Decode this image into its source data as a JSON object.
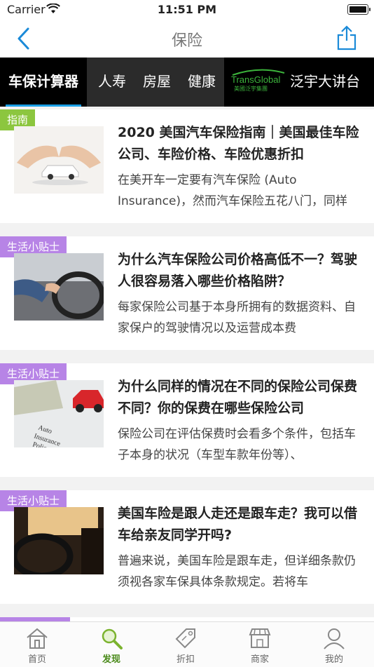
{
  "status_bar": {
    "carrier": "Carrier",
    "time": "11:51 PM"
  },
  "navbar": {
    "title": "保险",
    "back_icon": "chevron-left-icon",
    "share_icon": "share-icon"
  },
  "tabs": [
    {
      "label": "车保计算器",
      "active": true
    },
    {
      "label": "人寿"
    },
    {
      "label": "房屋"
    },
    {
      "label": "健康"
    }
  ],
  "brand_tab": {
    "logo_name": "TransGlobal",
    "logo_sub": "美國泛宇集團",
    "label": "泛宇大讲台"
  },
  "articles": [
    {
      "tag": "指南",
      "tag_color": "#8cc63f",
      "title": "2020 美国汽车保险指南｜美国最佳车险公司、车险价格、车险优惠折扣",
      "summary": "在美开车一定要有汽车保险 (Auto Insurance)，然而汽车保险五花八门，同样"
    },
    {
      "tag": "生活小贴士",
      "tag_color": "#b784e6",
      "title": "为什么汽车保险公司价格高低不一？驾驶人很容易落入哪些价格陷阱？",
      "summary": "每家保险公司基于本身所拥有的数据资料、自家保户的驾驶情况以及运营成本费"
    },
    {
      "tag": "生活小贴士",
      "tag_color": "#b784e6",
      "title": "为什么同样的情况在不同的保险公司保费不同？你的保费在哪些保险公司",
      "summary": "保险公司在评估保费时会看多个条件，包括车子本身的状况（车型车款年份等）、"
    },
    {
      "tag": "生活小贴士",
      "tag_color": "#b784e6",
      "title": "美国车险是跟人走还是跟车走？我可以借车给亲友同学开吗?",
      "summary": "普遍来说，美国车险是跟车走，但详细条款仍须视各家车保具体条款规定。若将车"
    }
  ],
  "bottom_tabs": [
    {
      "label": "首页",
      "icon": "home-icon"
    },
    {
      "label": "发现",
      "icon": "search-icon",
      "active": true
    },
    {
      "label": "折扣",
      "icon": "tag-icon"
    },
    {
      "label": "商家",
      "icon": "store-icon"
    },
    {
      "label": "我的",
      "icon": "user-icon"
    }
  ],
  "colors": {
    "accent": "#1aa0e6",
    "active_bottom": "#4a8a1a",
    "tab_bg": "#2b2b2b"
  }
}
